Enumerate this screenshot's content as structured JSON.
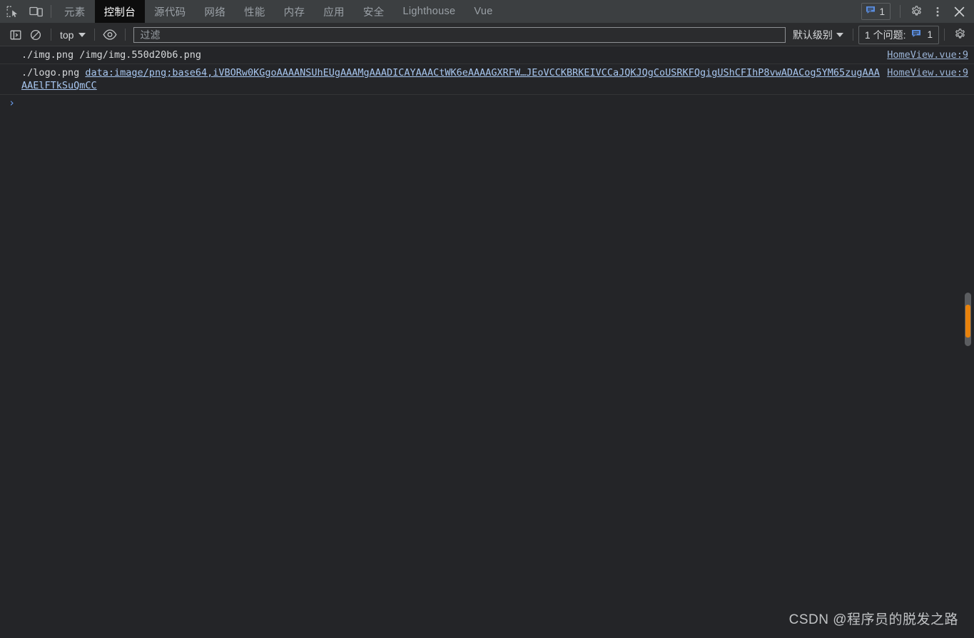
{
  "window": {
    "background": "#242528",
    "accent_blue": "#6a9bea",
    "warning_orange": "#e8820c"
  },
  "tabbar": {
    "inspect_icon": "inspect-element-icon",
    "device_icon": "device-toolbar-icon",
    "tabs": [
      {
        "label": "元素",
        "active": false,
        "name": "tab-elements"
      },
      {
        "label": "控制台",
        "active": true,
        "name": "tab-console"
      },
      {
        "label": "源代码",
        "active": false,
        "name": "tab-sources"
      },
      {
        "label": "网络",
        "active": false,
        "name": "tab-network"
      },
      {
        "label": "性能",
        "active": false,
        "name": "tab-performance"
      },
      {
        "label": "内存",
        "active": false,
        "name": "tab-memory"
      },
      {
        "label": "应用",
        "active": false,
        "name": "tab-application"
      },
      {
        "label": "安全",
        "active": false,
        "name": "tab-security"
      },
      {
        "label": "Lighthouse",
        "active": false,
        "name": "tab-lighthouse"
      },
      {
        "label": "Vue",
        "active": false,
        "name": "tab-vue"
      }
    ],
    "message_badge": {
      "icon": "message-bubble-icon",
      "count": "1"
    },
    "settings_icon": "gear-icon",
    "more_icon": "more-vertical-icon",
    "close_icon": "close-icon"
  },
  "console_toolbar": {
    "sidebar_toggle_icon": "show-console-sidebar-icon",
    "clear_icon": "clear-console-icon",
    "context": {
      "label": "top",
      "caret": "chevron-down-icon"
    },
    "eye_icon": "live-expression-icon",
    "filter": {
      "placeholder": "过滤",
      "value": ""
    },
    "level": {
      "label": "默认级别",
      "caret": "chevron-down-icon"
    },
    "issues": {
      "text": "1 个问题:",
      "icon": "issues-bubble-icon",
      "count": "1"
    },
    "settings_icon": "gear-icon"
  },
  "console_logs": [
    {
      "name": "console-log-row-1",
      "plain": "./img.png /img/img.550d20b6.png",
      "text": "./img.png /img/img.550d20b6.png",
      "link": "",
      "source": "HomeView.vue:9"
    },
    {
      "name": "console-log-row-2",
      "plain": "./logo.png ",
      "text": "./logo.png ",
      "link": "data:image/png;base64,iVBORw0KGgoAAAANSUhEUgAAAMgAAADICAYAAACtWK6eAAAAGXRFW…JEoVCCKBRKEIVCCaJQKJQgCoUSRKFQgigUShCFIhP8vwADACog5YM65zugAAAAAElFTkSuQmCC",
      "source": "HomeView.vue:9"
    }
  ],
  "prompt": {
    "caret": "›",
    "value": ""
  },
  "scrollbar": {
    "name": "vertical-scrollbar",
    "has_warning_marker": true
  },
  "watermark": {
    "text": "CSDN @程序员的脱发之路"
  }
}
